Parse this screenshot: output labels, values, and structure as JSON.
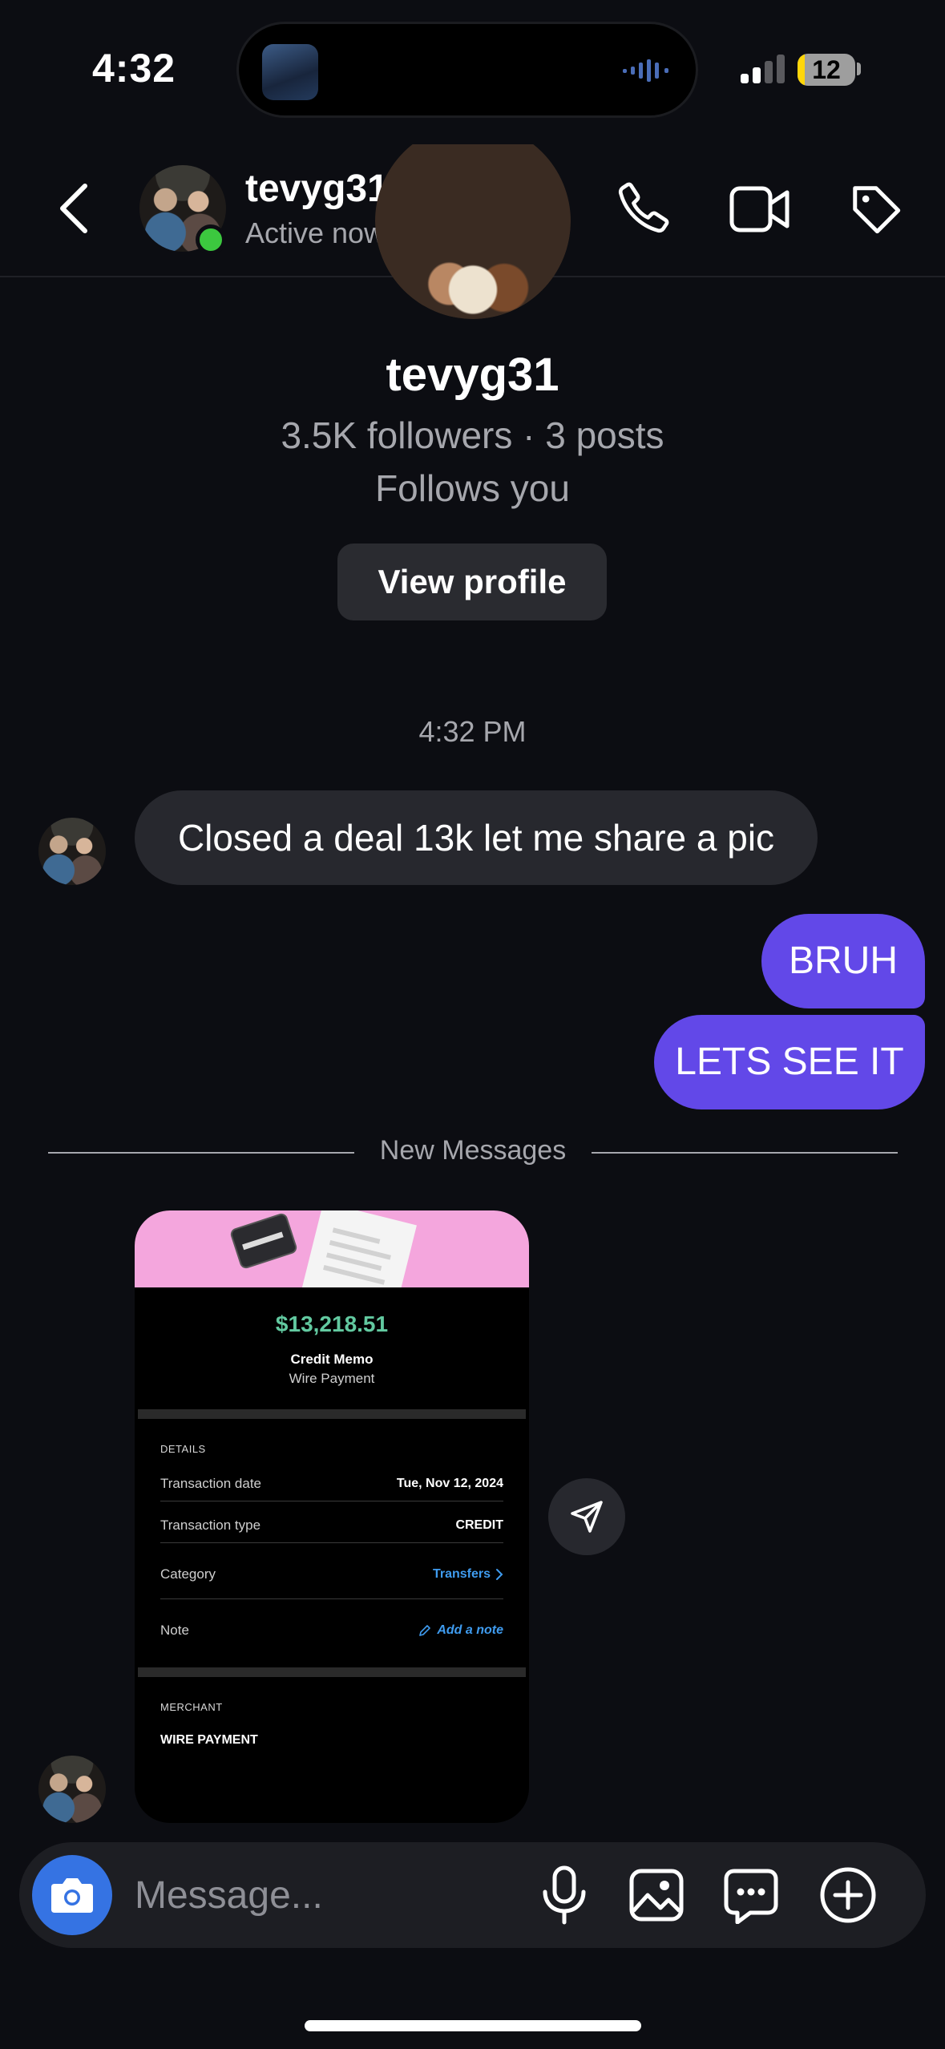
{
  "status_bar": {
    "time": "4:32",
    "battery": "12",
    "battery_level": 0.12
  },
  "header": {
    "username": "tevyg31",
    "status": "Active now"
  },
  "profile": {
    "name": "tevyg31",
    "stats": "3.5K followers · 3 posts",
    "follows": "Follows you",
    "view_profile_label": "View profile"
  },
  "chat": {
    "timestamp": "4:32 PM",
    "messages": [
      {
        "text": "Closed a deal 13k let me share a pic"
      },
      {
        "text": "BRUH"
      },
      {
        "text": "LETS SEE IT"
      }
    ],
    "new_messages_label": "New Messages"
  },
  "receipt": {
    "amount": "$13,218.51",
    "title": "Credit Memo",
    "subtitle": "Wire Payment",
    "details_header": "DETAILS",
    "rows": [
      {
        "label": "Transaction date",
        "value": "Tue, Nov 12, 2024"
      },
      {
        "label": "Transaction type",
        "value": "CREDIT"
      },
      {
        "label": "Category",
        "value": "Transfers"
      },
      {
        "label": "Note",
        "value": "Add a note"
      }
    ],
    "merchant_header": "MERCHANT",
    "merchant_name": "WIRE PAYMENT"
  },
  "composer": {
    "placeholder": "Message..."
  },
  "colors": {
    "outgoing_bubble": "#6248e8",
    "incoming_bubble": "#27282e",
    "online": "#3cc83f",
    "amount": "#62c9a0",
    "link": "#3f9cf0"
  }
}
